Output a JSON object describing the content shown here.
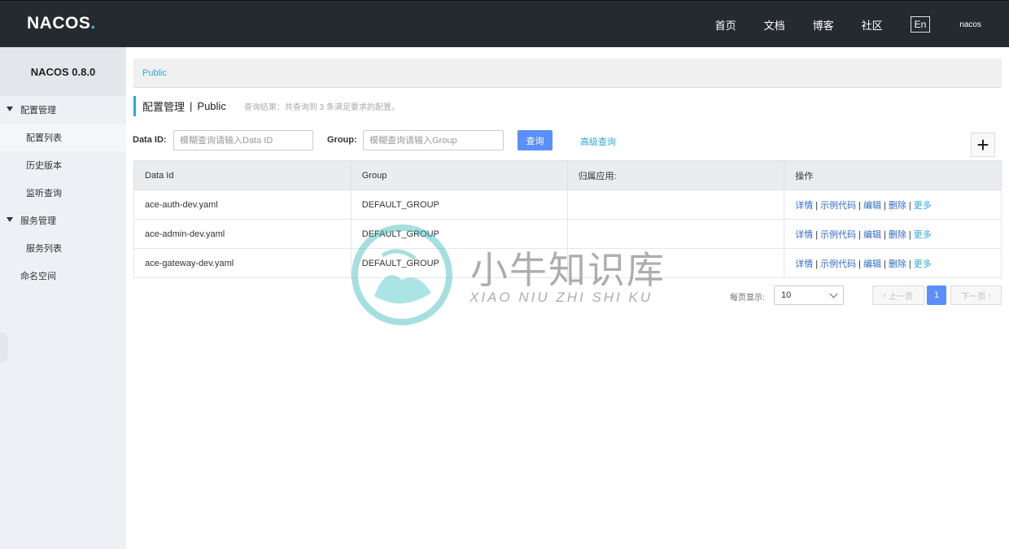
{
  "header": {
    "logo": "NACOS",
    "logo_dot": ".",
    "nav": [
      "首页",
      "文档",
      "博客",
      "社区"
    ],
    "lang": "En",
    "user": "nacos"
  },
  "sidebar": {
    "version": "NACOS 0.8.0",
    "config_group": "配置管理",
    "config_items": [
      "配置列表",
      "历史版本",
      "监听查询"
    ],
    "service_group": "服务管理",
    "service_items": [
      "服务列表"
    ],
    "namespace": "命名空间"
  },
  "main": {
    "breadcrumb": "Public",
    "title": "配置管理",
    "title_sep": "|",
    "namespace": "Public",
    "result_info": "查询结果：共查询到 3 条满足要求的配置。",
    "search": {
      "data_id_label": "Data ID:",
      "data_id_placeholder": "模糊查询请输入Data ID",
      "group_label": "Group:",
      "group_placeholder": "模糊查询请输入Group",
      "query_button": "查询",
      "advanced_link": "高级查询",
      "add_button": "+"
    },
    "table": {
      "headers": [
        "Data Id",
        "Group",
        "归属应用:",
        "操作"
      ],
      "rows": [
        {
          "data_id": "ace-auth-dev.yaml",
          "group": "DEFAULT_GROUP",
          "app": ""
        },
        {
          "data_id": "ace-admin-dev.yaml",
          "group": "DEFAULT_GROUP",
          "app": ""
        },
        {
          "data_id": "ace-gateway-dev.yaml",
          "group": "DEFAULT_GROUP",
          "app": ""
        }
      ],
      "ops": {
        "detail": "详情",
        "sample": "示例代码",
        "edit": "编辑",
        "delete": "删除",
        "more": "更多",
        "sep": "|"
      }
    },
    "pager": {
      "size_label": "每页显示:",
      "page_size": "10",
      "prev": "上一页",
      "current": "1",
      "next": "下一页"
    }
  },
  "watermark": {
    "cn": "小牛知识库",
    "en": "XIAO NIU ZHI SHI KU"
  },
  "colors": {
    "header_bg": "#252a2f",
    "accent": "#2fa8d8",
    "primary_button": "#5b8ff9",
    "sidebar_bg": "#eef0f5"
  }
}
